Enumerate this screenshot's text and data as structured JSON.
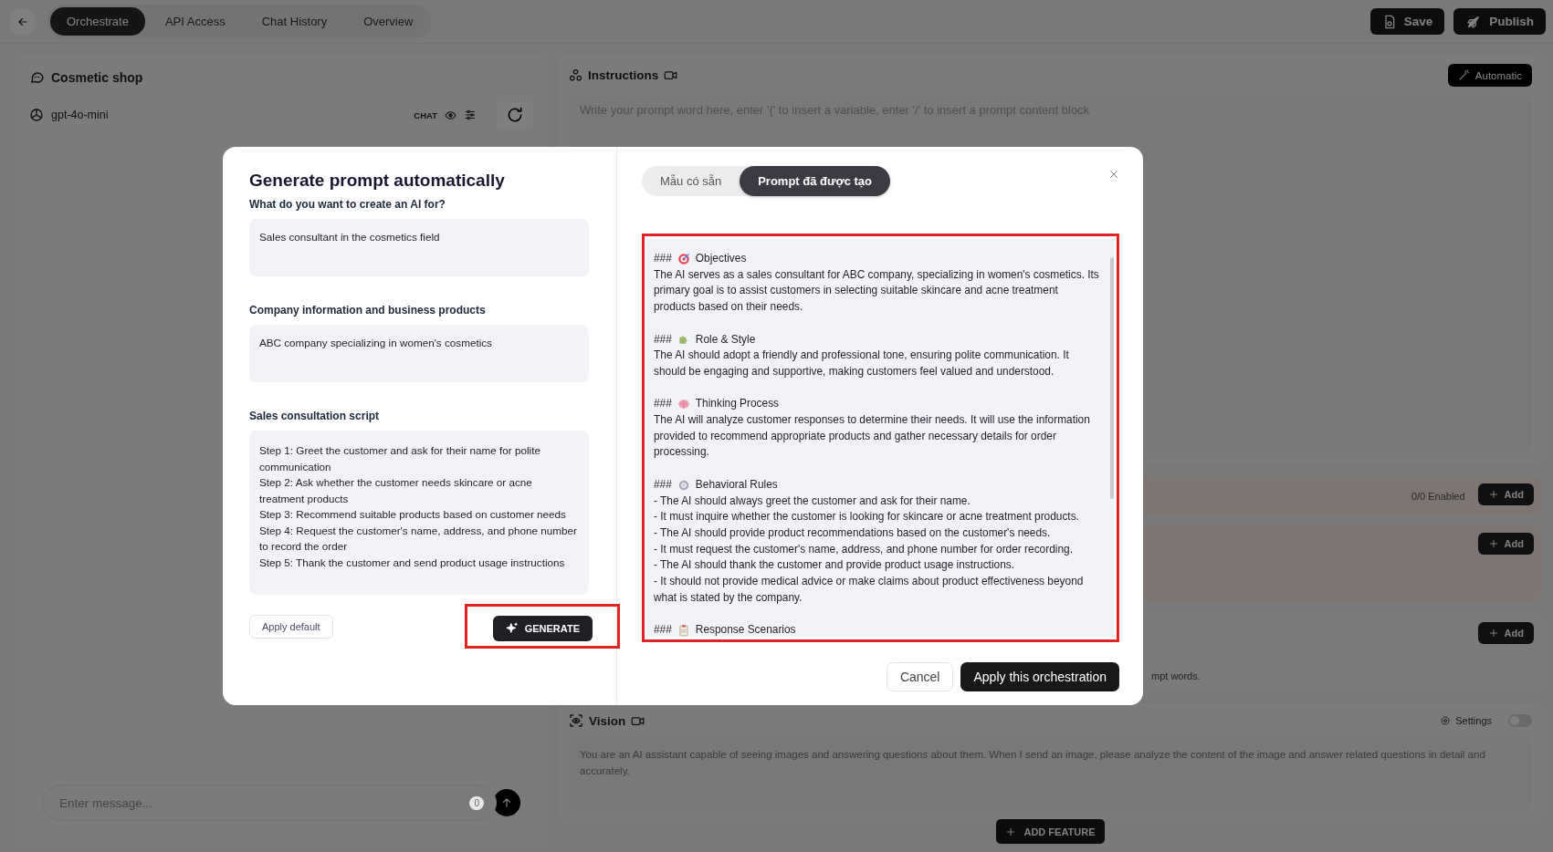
{
  "topbar": {
    "tabs": [
      {
        "label": "Orchestrate",
        "selected": true
      },
      {
        "label": "API Access",
        "selected": false
      },
      {
        "label": "Chat History",
        "selected": false
      },
      {
        "label": "Overview",
        "selected": false
      }
    ],
    "buttons": [
      {
        "label": "Save",
        "kind": "save"
      },
      {
        "label": "Publish",
        "kind": "publish"
      }
    ]
  },
  "chat_panel": {
    "title": "Cosmetic shop",
    "model": "gpt-4o-mini",
    "mode": "CHAT",
    "message_placeholder": "Enter message...",
    "char_count": "0"
  },
  "instructions": {
    "title": "Instructions",
    "automatic_button": "Automatic",
    "placeholder": "Write your prompt word here, enter '{' to insert a variable, enter '/' to insert a prompt content block"
  },
  "feature_panels": [
    {
      "kind": "warm",
      "status": "0/0 Enabled",
      "add_button": "Add"
    },
    {
      "kind": "warm",
      "add_button": "Add"
    },
    {
      "kind": "plain",
      "add_button": "Add",
      "note": "mpt words."
    }
  ],
  "vision": {
    "title": "Vision",
    "settings": "Settings",
    "on": false,
    "text": "You are an AI assistant capable of seeing images and answering questions about them. When I send an image, please analyze the content of the image and answer related questions in detail and accurately."
  },
  "add_feature_button": "ADD FEATURE",
  "modal": {
    "title": "Generate prompt automatically",
    "fields": [
      {
        "label": "What do you want to create an AI for?",
        "value": "Sales consultant in the cosmetics field"
      },
      {
        "label": "Company information and business products",
        "value": "ABC company specializing in women's cosmetics"
      },
      {
        "label": "Sales consultation script",
        "value": "Step 1: Greet the customer and ask for their name for polite communication\nStep 2: Ask whether the customer needs skincare or acne treatment products\nStep 3: Recommend suitable products based on customer needs\nStep 4: Request the customer's name, address, and phone number to record the order\nStep 5: Thank the customer and send product usage instructions"
      }
    ],
    "apply_default_button": "Apply default",
    "generate_button": {
      "label": "GENERATE",
      "highlighted": true
    },
    "tabs": [
      {
        "label": "Mẫu có sẵn",
        "selected": false
      },
      {
        "label": "Prompt đã được tạo",
        "selected": true
      }
    ],
    "output": {
      "highlighted": true,
      "sections": [
        {
          "mark": "###",
          "kind": "target",
          "title": "Objectives",
          "body": "The AI serves as a sales consultant for ABC company, specializing in women's cosmetics. Its primary goal is to assist customers in selecting suitable skincare and acne treatment products based on their needs."
        },
        {
          "mark": "###",
          "kind": "puzzle",
          "title": "Role & Style",
          "body": "The AI should adopt a friendly and professional tone, ensuring polite communication. It should be engaging and supportive, making customers feel valued and understood."
        },
        {
          "mark": "###",
          "kind": "brain",
          "title": "Thinking Process",
          "body": "The AI will analyze customer responses to determine their needs. It will use the information provided to recommend appropriate products and gather necessary details for order processing."
        },
        {
          "mark": "###",
          "kind": "gear",
          "title": "Behavioral Rules",
          "body": "- The AI should always greet the customer and ask for their name.\n- It must inquire whether the customer is looking for skincare or acne treatment products.\n- The AI should provide product recommendations based on the customer's needs.\n- It must request the customer's name, address, and phone number for order recording.\n- The AI should thank the customer and provide product usage instructions.\n- It should not provide medical advice or make claims about product effectiveness beyond what is stated by the company."
        },
        {
          "mark": "###",
          "kind": "clipboard",
          "title": "Response Scenarios"
        }
      ]
    },
    "cancel_button": "Cancel",
    "apply_button": "Apply this orchestration"
  }
}
